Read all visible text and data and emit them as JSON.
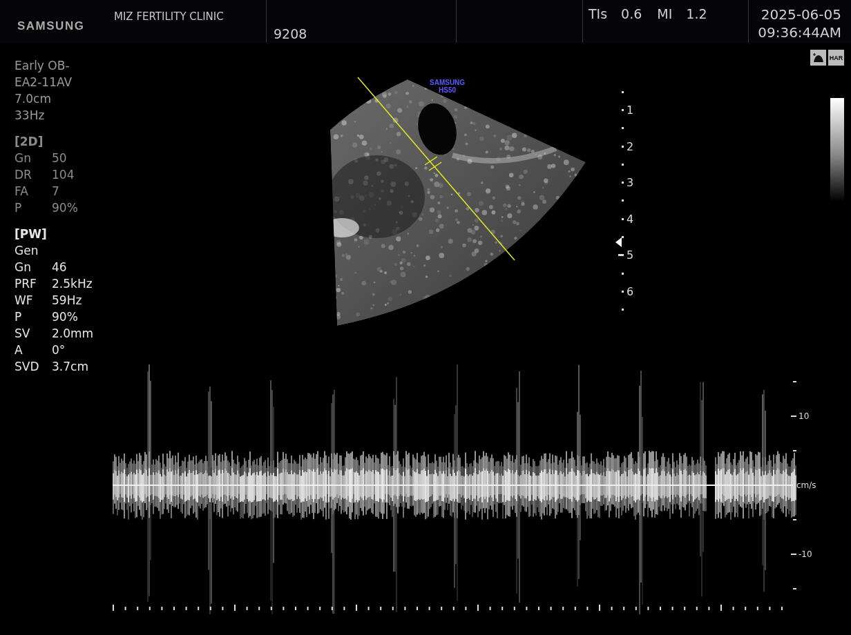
{
  "header": {
    "logo": "SAMSUNG",
    "clinic": "MIZ FERTILITY CLINIC",
    "patient_id": "9208",
    "indices": [
      {
        "label": "TIs",
        "value": "0.6"
      },
      {
        "label": "MI",
        "value": "1.2"
      }
    ],
    "date": "2025-06-05",
    "time": "09:36:44AM"
  },
  "probe_info": [
    "Early OB-",
    "EA2-11AV",
    "7.0cm",
    "33Hz"
  ],
  "sections": [
    {
      "title": "[2D]",
      "active": false,
      "params": [
        {
          "label": "Gn",
          "value": "50"
        },
        {
          "label": "DR",
          "value": "104"
        },
        {
          "label": "FA",
          "value": "7"
        },
        {
          "label": "P",
          "value": "90%"
        }
      ]
    },
    {
      "title": "[PW]",
      "active": true,
      "params": [
        {
          "label": "Gen"
        },
        {
          "label": "Gn",
          "value": "46"
        },
        {
          "label": "PRF",
          "value": "2.5kHz"
        },
        {
          "label": "WF",
          "value": "59Hz"
        },
        {
          "label": "P",
          "value": "90%"
        },
        {
          "label": "SV",
          "value": "2.0mm"
        },
        {
          "label": "A",
          "value": "0°"
        },
        {
          "label": "SVD",
          "value": "3.7cm"
        }
      ]
    }
  ],
  "image": {
    "brand": "SAMSUNG",
    "model": "HS50"
  },
  "status_badges": [
    {
      "kind": "icon"
    },
    {
      "kind": "text",
      "text": "HAR"
    }
  ],
  "depth_scale": [
    "1",
    "2",
    "3",
    "4",
    "5",
    "6"
  ],
  "velocity_scale": {
    "ticks": [
      "10",
      "-10"
    ],
    "unit": "cm/s"
  }
}
